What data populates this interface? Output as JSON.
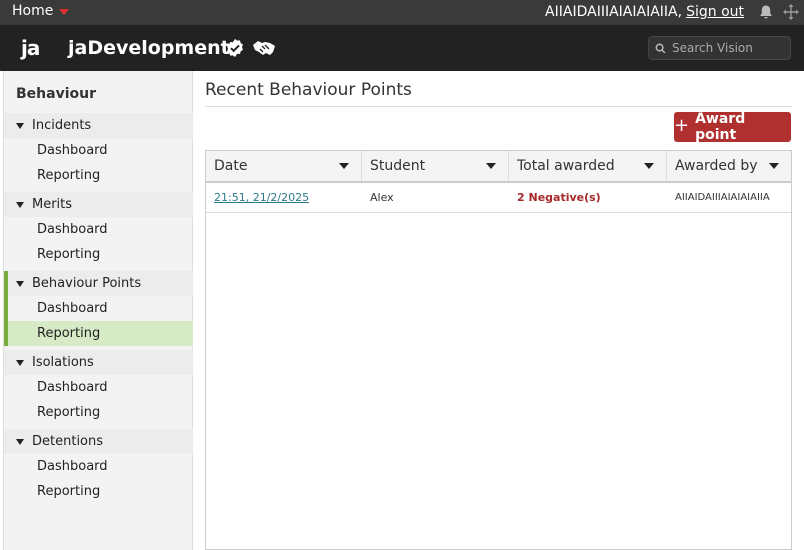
{
  "topbar": {
    "home_label": "Home",
    "user_name": "AIIAIDAIIIAIAIAIAIIA,",
    "signout_label": "Sign out",
    "icons": {
      "bell": "bell-icon",
      "move": "move-icon"
    },
    "accent": "#e0312e"
  },
  "header": {
    "logo_text": "ja",
    "app_name": "jaDevelopment",
    "icons": {
      "verified": "verified-badge-icon",
      "handshake": "handshake-icon",
      "search": "search-icon"
    },
    "search_placeholder": "Search Vision"
  },
  "sidebar": {
    "title": "Behaviour",
    "groups": [
      {
        "label": "Incidents",
        "items": [
          "Dashboard",
          "Reporting"
        ]
      },
      {
        "label": "Merits",
        "items": [
          "Dashboard",
          "Reporting"
        ]
      },
      {
        "label": "Behaviour Points",
        "items": [
          "Dashboard",
          "Reporting"
        ]
      },
      {
        "label": "Isolations",
        "items": [
          "Dashboard",
          "Reporting"
        ]
      },
      {
        "label": "Detentions",
        "items": [
          "Dashboard",
          "Reporting"
        ]
      }
    ],
    "active_color": "#79ad3f",
    "selected_bg": "#d6eac5"
  },
  "main": {
    "title": "Recent Behaviour Points",
    "award_button_label": "Award point",
    "award_button_color": "#b0302f",
    "table": {
      "columns": [
        "Date",
        "Student",
        "Total awarded",
        "Awarded by"
      ],
      "rows": [
        {
          "date": "21:51, 21/2/2025",
          "student": "Alex",
          "total": "2 Negative(s)",
          "awarded_by": "AIIAIDAIIIAIAIAIAIIA"
        }
      ]
    }
  }
}
